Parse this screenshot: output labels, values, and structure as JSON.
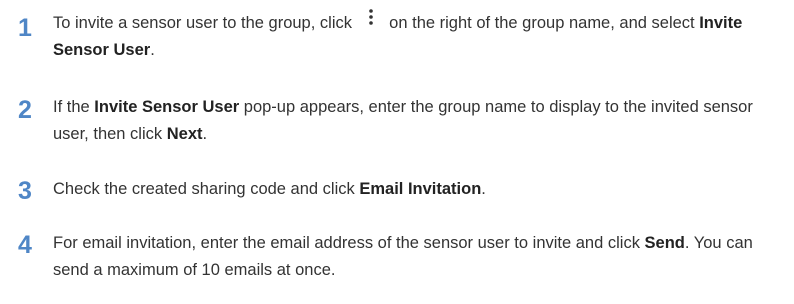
{
  "steps": [
    {
      "number": "1",
      "parts": {
        "a": "To invite a sensor user to the group, click",
        "b": "on the right of the group name, and select",
        "c": "Invite Sensor User",
        "d": "."
      }
    },
    {
      "number": "2",
      "parts": {
        "a": "If the",
        "b": "Invite Sensor User",
        "c": "pop-up appears, enter the group name to display to the invited sensor user, then click",
        "d": "Next",
        "e": "."
      }
    },
    {
      "number": "3",
      "parts": {
        "a": "Check the created sharing code and click",
        "b": "Email Invitation",
        "c": "."
      }
    },
    {
      "number": "4",
      "parts": {
        "a": "For email invitation, enter the email address of the sensor user to invite and click",
        "b": "Send",
        "c": ". You can send a maximum of 10 emails at once."
      }
    }
  ],
  "icons": {
    "more_menu": "more-vertical-icon"
  },
  "colors": {
    "step_number": "#4f86c6",
    "body_text": "#333333"
  }
}
